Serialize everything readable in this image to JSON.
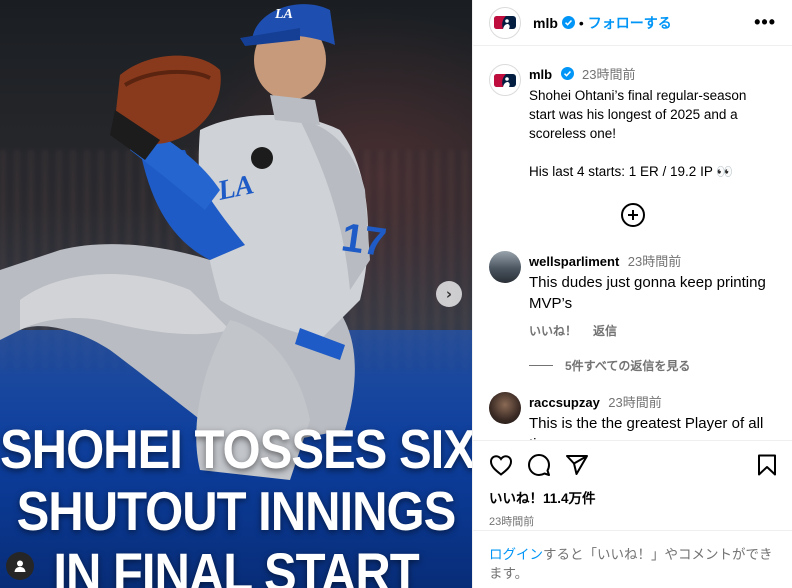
{
  "post": {
    "headline_lines": [
      "SHOHEI TOSSES SIX",
      "SHUTOUT INNINGS",
      "IN FINAL START"
    ],
    "next_arrow": "›"
  },
  "header": {
    "username": "mlb",
    "separator": "•",
    "follow_label": "フォローする",
    "more_label": "•••"
  },
  "caption": {
    "username": "mlb",
    "time": "23時間前",
    "text": "Shohei Ohtani’s final regular-season start was his longest of 2025 and a scoreless one!\n\nHis last 4 starts: 1 ER / 19.2 IP 👀"
  },
  "comments": [
    {
      "username": "wellsparliment",
      "time": "23時間前",
      "text": "This dudes just gonna keep printing MVP’s",
      "like_label": "いいね！",
      "reply_label": "返信",
      "view_replies": "5件すべての返信を見る"
    },
    {
      "username": "raccsupzay",
      "time": "23時間前",
      "text": "This is the the greatest Player of all time"
    }
  ],
  "stats": {
    "likes": "いいね！11.4万件",
    "posted": "23時間前"
  },
  "login": {
    "link": "ログイン",
    "rest": "すると「いいね！」やコメントができます。"
  },
  "colors": {
    "accent": "#0095f6",
    "secondary_text": "#737373",
    "dodger_blue": "#1e5bc6"
  },
  "icons": [
    "mlb-logo-icon",
    "verified-icon",
    "more-icon",
    "add-comment-icon",
    "heart-icon",
    "comment-icon",
    "share-icon",
    "bookmark-icon",
    "next-arrow-icon",
    "tag-user-icon"
  ]
}
